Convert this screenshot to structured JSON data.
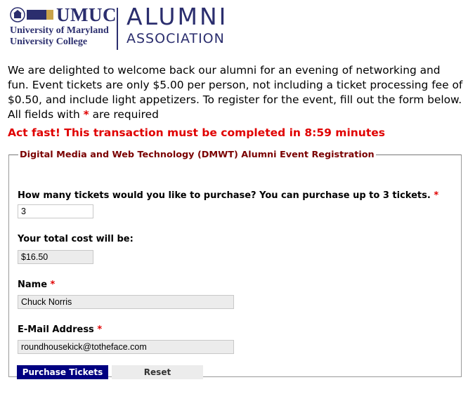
{
  "header": {
    "brand_short": "UMUC",
    "brand_line1": "University of Maryland",
    "brand_line2": "University College",
    "alumni_line1": "ALUMNI",
    "alumni_line2": "ASSOCIATION",
    "brand_color": "#2b2e6e"
  },
  "intro": {
    "text": "We are delighted to welcome back our alumni for an evening of networking and fun. Event tickets are only $5.00 per person, not including a ticket processing fee of $0.50, and include light appetizers. To register for the event, fill out the form below. All fields with ",
    "required_marker": "*",
    "text_end": " are required"
  },
  "timer": {
    "text": "Act fast! This transaction must be completed in 8:59 minutes",
    "color": "#e00000"
  },
  "form": {
    "legend": "Digital Media and Web Technology (DMWT) Alumni Event Registration",
    "tickets": {
      "label": "How many tickets would you like to purchase? You can purchase up to 3 tickets.",
      "required_marker": "*",
      "value": "3"
    },
    "total": {
      "label": "Your total cost will be:",
      "value": "$16.50"
    },
    "name": {
      "label": "Name",
      "required_marker": "*",
      "value": "Chuck Norris"
    },
    "email": {
      "label": "E-Mail Address",
      "required_marker": "*",
      "value": "roundhousekick@totheface.com"
    },
    "purchase_label": "Purchase Tickets",
    "reset_label": "Reset"
  }
}
